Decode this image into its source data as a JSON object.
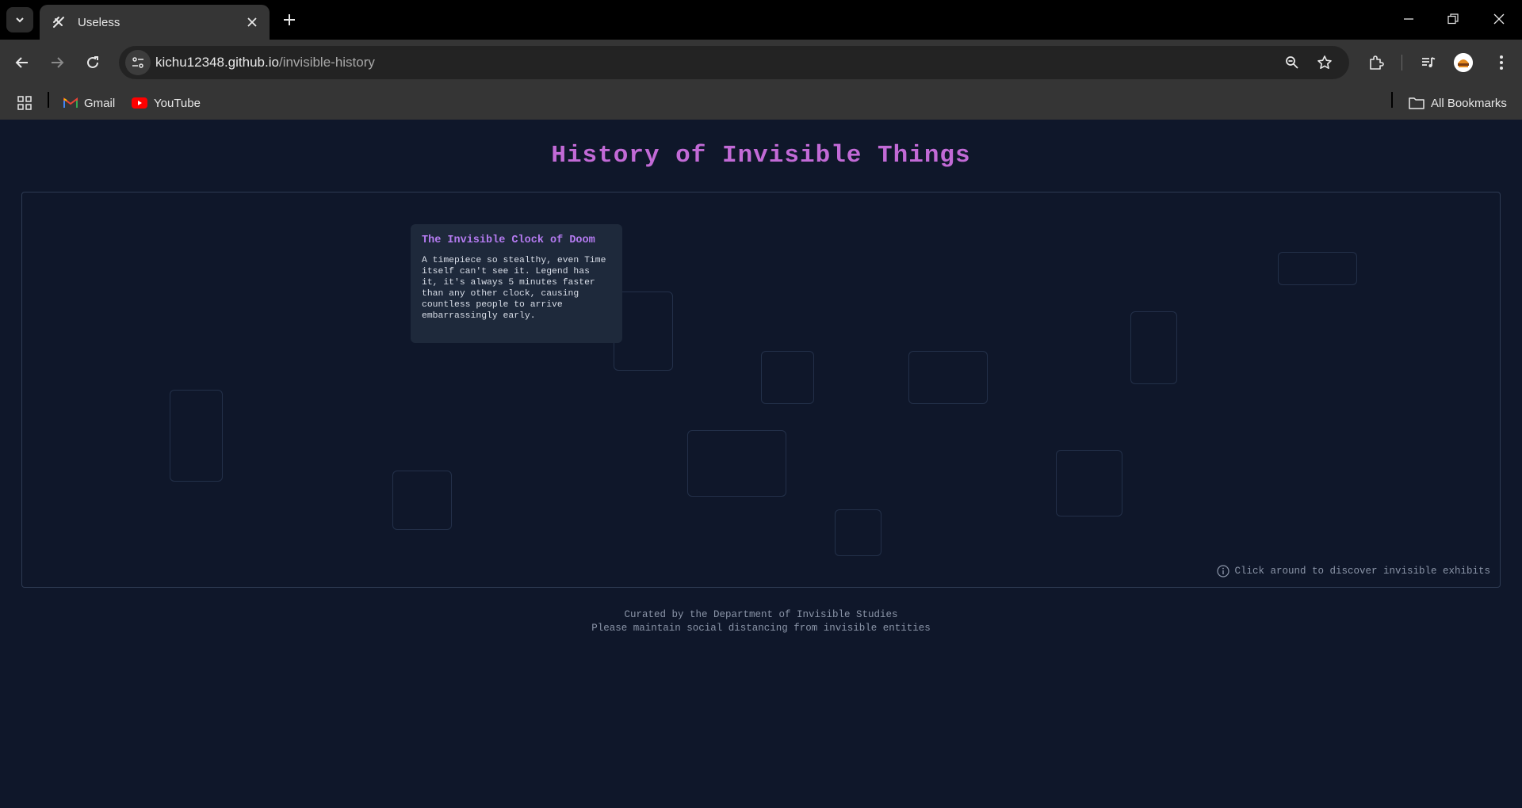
{
  "browser": {
    "tab_title": "Useless",
    "url_host": "kichu12348.github.io",
    "url_path": "/invisible-history",
    "bookmarks": [
      {
        "label": "Gmail",
        "icon": "gmail-icon"
      },
      {
        "label": "YouTube",
        "icon": "youtube-icon"
      }
    ],
    "all_bookmarks_label": "All Bookmarks"
  },
  "page": {
    "title": "History of Invisible Things",
    "exhibit_card": {
      "title": "The Invisible Clock of Doom",
      "description": "A timepiece so stealthy, even Time itself can't see it. Legend has it, it's always 5 minutes faster than any other clock, causing countless people to arrive embarrassingly early."
    },
    "hint": "Click around to discover invisible exhibits",
    "footer_line1": "Curated by the Department of Invisible Studies",
    "footer_line2": "Please maintain social distancing from invisible entities"
  },
  "colors": {
    "page_background": "#0f172a",
    "title": "#c26ad6",
    "card_title": "#b57bf1",
    "card_background": "#1e293b"
  }
}
